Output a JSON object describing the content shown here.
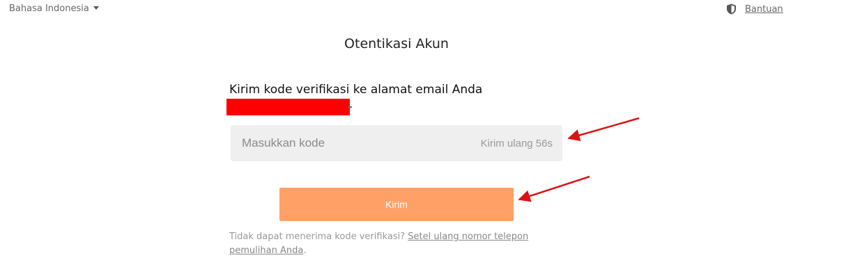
{
  "header": {
    "language": "Bahasa Indonesia",
    "help": "Bantuan"
  },
  "page": {
    "title": "Otentikasi Akun",
    "instruction": "Kirim kode verifikasi ke alamat email Anda"
  },
  "form": {
    "code_placeholder": "Masukkan kode",
    "resend_label": "Kirim ulang 56s",
    "submit_label": "Kirim"
  },
  "footer": {
    "note": "Tidak dapat menerima kode verifikasi?",
    "link_text": "Setel ulang nomor telepon pemulihan Anda",
    "end": "."
  },
  "icons": {
    "language_caret": "caret-down-icon",
    "help": "shield-icon"
  },
  "colors": {
    "submit_button": "#ffa167",
    "redaction": "#ff0000",
    "annotation_arrow": "#dd1111"
  }
}
